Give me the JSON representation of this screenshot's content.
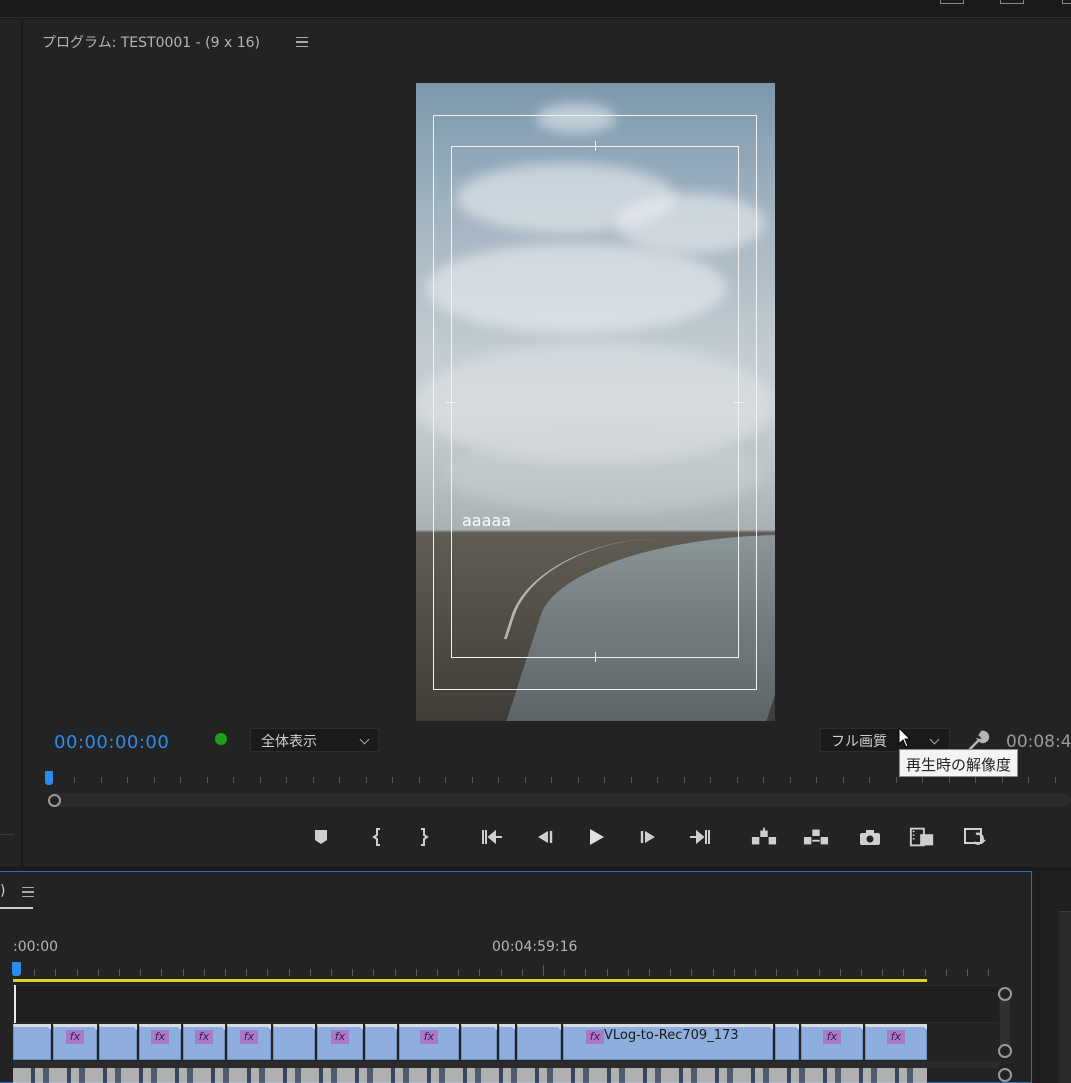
{
  "program_monitor": {
    "title": "プログラム: TEST0001 - (9 x 16)",
    "menu_icon": "hamburger-menu-icon",
    "overlay_text": "aaaaa",
    "current_timecode": "00:00:00:00",
    "timecode_color": "#2d8ceb",
    "status_dot_color": "#1aa31a",
    "zoom_select": {
      "value": "全体表示"
    },
    "quality_select": {
      "value": "フル画質"
    },
    "tooltip": "再生時の解像度",
    "duration": "00:08:4",
    "settings_icon": "wrench-icon",
    "transport": [
      {
        "name": "add-marker",
        "icon": "marker-icon"
      },
      {
        "name": "mark-in",
        "icon": "mark-in-icon"
      },
      {
        "name": "mark-out",
        "icon": "mark-out-icon"
      },
      {
        "name": "go-to-in",
        "icon": "go-to-in-icon"
      },
      {
        "name": "step-back",
        "icon": "step-back-icon"
      },
      {
        "name": "play",
        "icon": "play-icon"
      },
      {
        "name": "step-forward",
        "icon": "step-forward-icon"
      },
      {
        "name": "go-to-out",
        "icon": "go-to-out-icon"
      },
      {
        "name": "lift",
        "icon": "lift-icon"
      },
      {
        "name": "extract",
        "icon": "extract-icon"
      },
      {
        "name": "export-frame",
        "icon": "camera-icon"
      },
      {
        "name": "comparison-view",
        "icon": "film-compare-icon"
      },
      {
        "name": "vr-toggle",
        "icon": "loop-icon"
      }
    ]
  },
  "timeline": {
    "tab_close": ")",
    "time_start": ":00:00",
    "time_mid": "00:04:59:16",
    "work_area_color": "#d8d22a",
    "clip_label": "VLog-to-Rec709_173",
    "fx_label": "fx",
    "clip_color": "#8eaede"
  }
}
